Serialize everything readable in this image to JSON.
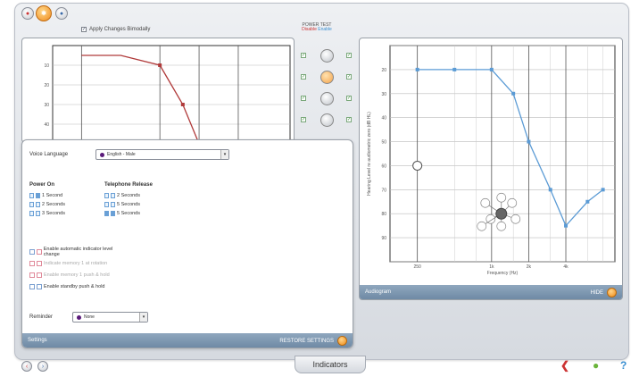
{
  "toolbar": {
    "apply_label": "Apply Changes Bimodally"
  },
  "power_test": {
    "title": "POWER TEST",
    "disable_label": "Disable",
    "enable_label": "Enable"
  },
  "settings": {
    "voice_language_label": "Voice Language",
    "voice_language_value": "English - Male",
    "power_on_title": "Power On",
    "power_on_options": [
      "1 Second",
      "2 Seconds",
      "3 Seconds"
    ],
    "telephone_release_title": "Telephone Release",
    "telephone_release_options": [
      "2 Seconds",
      "5 Seconds",
      "5 Seconds"
    ],
    "mode_options": [
      {
        "label": "Enable automatic indicator level change",
        "enabled": true
      },
      {
        "label": "Indicate memory 1 at rotation",
        "enabled": false
      },
      {
        "label": "Enable memory 1 push & hold",
        "enabled": false
      },
      {
        "label": "Enable standby push & hold",
        "enabled": true
      }
    ],
    "reminder_label": "Reminder",
    "reminder_value": "None",
    "footer_label": "Settings",
    "footer_action": "RESTORE SETTINGS"
  },
  "audiogram": {
    "footer_label": "Audiogram",
    "footer_action": "HIDE",
    "ylabel": "Hearing Level re audiometric zero (dB HL)",
    "xlabel": "Frequency (Hz)",
    "x_ticks": [
      "250",
      "1k",
      "2k",
      "4k"
    ],
    "y_ticks": [
      "20",
      "30",
      "40",
      "50",
      "60",
      "70",
      "80",
      "90"
    ],
    "color": "#5b9bd5"
  },
  "left_chart": {
    "y_ticks": [
      "10",
      "20",
      "30",
      "40"
    ],
    "color": "#b03a3a"
  },
  "footer": {
    "tab_label": "Indicators"
  },
  "chart_data": [
    {
      "type": "line",
      "name": "audiogram",
      "x": [
        250,
        500,
        1000,
        1500,
        2000,
        3000,
        4000,
        6000,
        8000
      ],
      "y": [
        20,
        20,
        20,
        30,
        50,
        70,
        85,
        75,
        70
      ],
      "xlabel": "Frequency (Hz)",
      "ylabel": "Hearing Level re audiometric zero (dB HL)",
      "ylim": [
        10,
        100
      ],
      "grid": true
    },
    {
      "type": "line",
      "name": "left-chart",
      "x": [
        250,
        500,
        1000,
        1500,
        2000
      ],
      "y": [
        5,
        5,
        10,
        30,
        50
      ],
      "ylim": [
        0,
        50
      ],
      "grid": true
    }
  ]
}
